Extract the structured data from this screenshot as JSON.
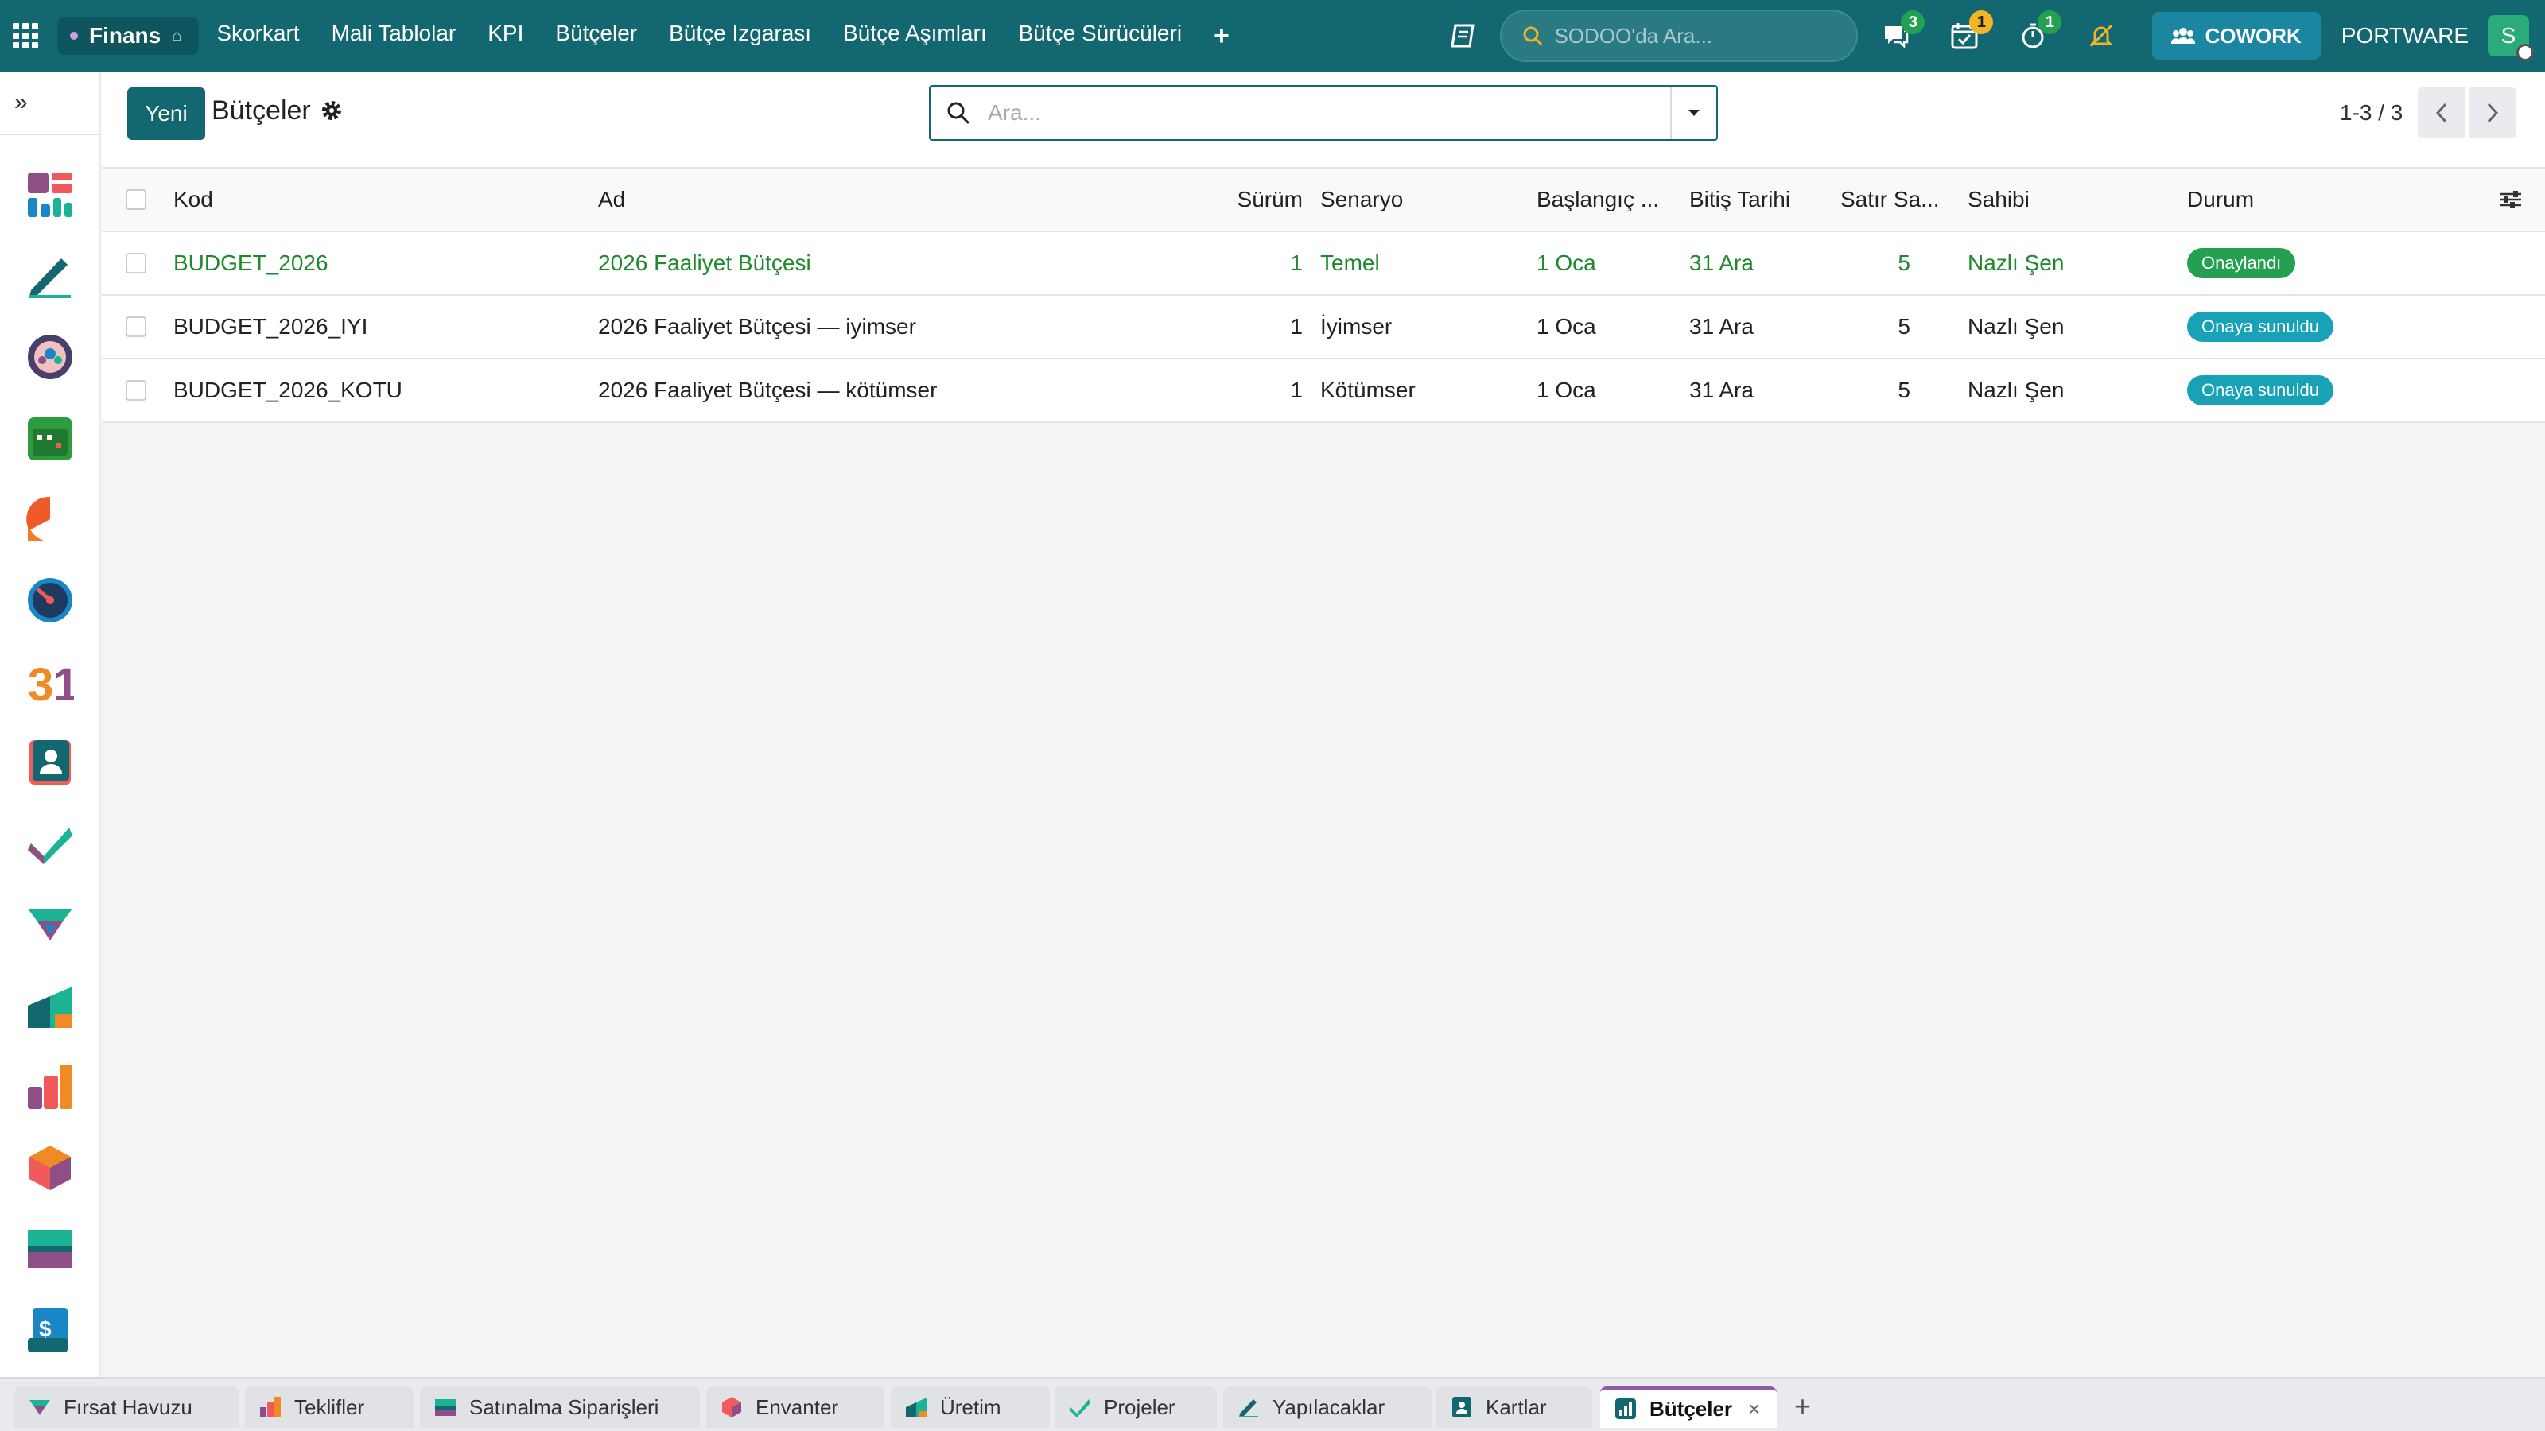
{
  "topbar": {
    "app_name": "Finans",
    "menu": [
      "Skorkart",
      "Mali Tablolar",
      "KPI",
      "Bütçeler",
      "Bütçe Izgarası",
      "Bütçe Aşımları",
      "Bütçe Sürücüleri"
    ],
    "add_menu": "+",
    "search_placeholder": "SODOO'da Ara...",
    "messages_count": "3",
    "activities_count": "1",
    "timer_count": "1",
    "cowork_label": "COWORK",
    "company": "PORTWARE",
    "user_initial": "S"
  },
  "control_panel": {
    "new_label": "Yeni",
    "title": "Bütçeler",
    "search_placeholder": "Ara...",
    "pager": "1-3 / 3"
  },
  "list": {
    "columns": [
      "Kod",
      "Ad",
      "Sürüm",
      "Senaryo",
      "Başlangıç ...",
      "Bitiş Tarihi",
      "Satır Sa...",
      "Sahibi",
      "Durum"
    ],
    "rows": [
      {
        "kod": "BUDGET_2026",
        "ad": "2026 Faaliyet Bütçesi",
        "surum": "1",
        "senaryo": "Temel",
        "baslangic": "1 Oca",
        "bitis": "31 Ara",
        "satir": "5",
        "sahibi": "Nazlı Şen",
        "durum": "Onaylandı"
      },
      {
        "kod": "BUDGET_2026_IYI",
        "ad": "2026 Faaliyet Bütçesi — iyimser",
        "surum": "1",
        "senaryo": "İyimser",
        "baslangic": "1 Oca",
        "bitis": "31 Ara",
        "satir": "5",
        "sahibi": "Nazlı Şen",
        "durum": "Onaya sunuldu"
      },
      {
        "kod": "BUDGET_2026_KOTU",
        "ad": "2026 Faaliyet Bütçesi — kötümser",
        "surum": "1",
        "senaryo": "Kötümser",
        "baslangic": "1 Oca",
        "bitis": "31 Ara",
        "satir": "5",
        "sahibi": "Nazlı Şen",
        "durum": "Onaya sunuldu"
      }
    ]
  },
  "tabs": [
    {
      "label": "Fırsat Havuzu",
      "icon": "crm-icon"
    },
    {
      "label": "Teklifler",
      "icon": "sales-icon"
    },
    {
      "label": "Satınalma Siparişleri",
      "icon": "purchase-icon"
    },
    {
      "label": "Envanter",
      "icon": "inventory-icon"
    },
    {
      "label": "Üretim",
      "icon": "manufacturing-icon"
    },
    {
      "label": "Projeler",
      "icon": "project-icon"
    },
    {
      "label": "Yapılacaklar",
      "icon": "todo-icon"
    },
    {
      "label": "Kartlar",
      "icon": "cards-icon"
    },
    {
      "label": "Bütçeler",
      "icon": "budget-icon",
      "active": true
    }
  ],
  "tab_close": "×",
  "tab_add": "+",
  "colors": {
    "brand": "#136770",
    "success": "#23a050",
    "info": "#17a2b8",
    "link_green": "#1f8a2c"
  }
}
